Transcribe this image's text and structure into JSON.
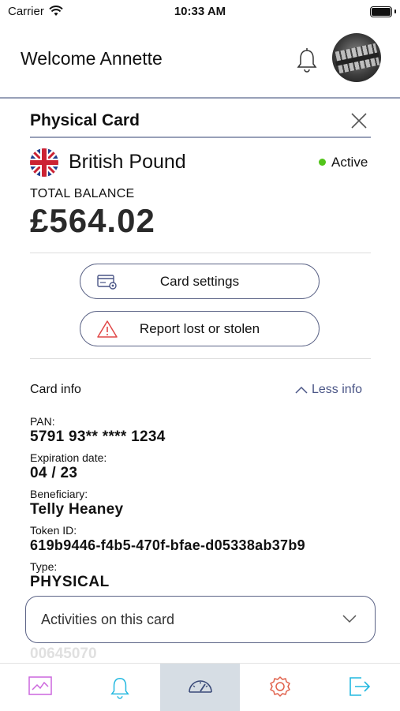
{
  "status_bar": {
    "carrier": "Carrier",
    "time": "10:33 AM"
  },
  "header": {
    "welcome": "Welcome Annette",
    "bell_icon": "bell-icon",
    "avatar": "avatar"
  },
  "panel": {
    "title": "Physical Card",
    "currency": "British Pound",
    "status": "Active",
    "status_color": "#52c41a",
    "balance_label": "TOTAL BALANCE",
    "balance": "£564.02",
    "buttons": {
      "settings": "Card settings",
      "report": "Report lost or stolen"
    },
    "card_info": {
      "heading": "Card info",
      "toggle": "Less info",
      "fields": [
        {
          "label": "PAN:",
          "value": "5791 93** **** 1234"
        },
        {
          "label": "Expiration date:",
          "value": "04 / 23"
        },
        {
          "label": "Beneficiary:",
          "value": "Telly Heaney"
        },
        {
          "label": "Token ID:",
          "value": "619b9446-f4b5-470f-bfae-d05338ab37b9"
        },
        {
          "label": "Type:",
          "value": "PHYSICAL"
        }
      ]
    },
    "activities": "Activities on this card",
    "partial_text": "00645070"
  },
  "tabbar": {
    "tabs": [
      {
        "name": "analytics-icon",
        "color": "#cc66dd"
      },
      {
        "name": "notifications-icon",
        "color": "#22b8e0"
      },
      {
        "name": "dashboard-icon",
        "color": "#3a4a78"
      },
      {
        "name": "settings-icon",
        "color": "#e0604a"
      },
      {
        "name": "logout-icon",
        "color": "#22b8e0"
      }
    ]
  },
  "colors": {
    "accent": "#5b6386",
    "divider": "#98a0b8",
    "active_tab": "#d6dde4"
  }
}
